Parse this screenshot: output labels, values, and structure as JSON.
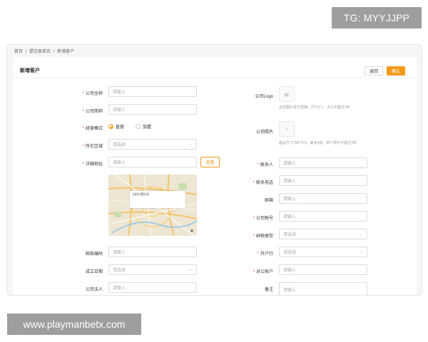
{
  "watermarks": {
    "top": "TG: MYYJJPP",
    "bottom": "www.playmanbetx.com"
  },
  "breadcrumb": [
    "首页",
    "/",
    "提交表单页",
    "/",
    "新增客户"
  ],
  "page": {
    "title": "新增客户",
    "back_label": "返回",
    "confirm_label": "确认"
  },
  "left_form": {
    "company_name": {
      "label": "公司全称",
      "placeholder": "请输入"
    },
    "company_short": {
      "label": "公司简称",
      "placeholder": "请输入"
    },
    "business_mode": {
      "label": "经营模式",
      "options": [
        "直营",
        "加盟"
      ],
      "selected": "直营"
    },
    "region": {
      "label": "所在区域",
      "placeholder": "请选择"
    },
    "address": {
      "label": "详细地址",
      "placeholder": "请输入",
      "view_label": "查看"
    },
    "map_popup": "当前位置信息...",
    "postcode": {
      "label": "邮政编码",
      "placeholder": "请输入"
    },
    "founded": {
      "label": "成立日期",
      "placeholder": "请选择"
    },
    "legal_person": {
      "label": "公司法人",
      "placeholder": "请输入"
    }
  },
  "right_form": {
    "logo": {
      "label": "公司Logo",
      "hint": "点击图片进行替换，尺寸1:1，大小不超过7M"
    },
    "photos": {
      "label": "公司照片",
      "hint": "建议尺寸750*370，最多4张，单个照片不超过7M"
    },
    "contact": {
      "label": "联系人",
      "placeholder": "请输入"
    },
    "phone": {
      "label": "联系电话",
      "placeholder": "请输入"
    },
    "email": {
      "label": "邮箱",
      "placeholder": "请输入"
    },
    "tax_no": {
      "label": "公司税号",
      "placeholder": "请输入"
    },
    "tax_type": {
      "label": "纳税类型",
      "placeholder": "请选择"
    },
    "bank": {
      "label": "开户行",
      "placeholder": "请选择"
    },
    "account": {
      "label": "对公账户",
      "placeholder": "请输入"
    },
    "remark": {
      "label": "备注",
      "placeholder": "请输入"
    }
  },
  "icons": {
    "chevron": "chevron-down-icon",
    "calendar": "calendar-icon",
    "image": "image-icon",
    "plus": "plus-icon"
  },
  "colors": {
    "accent": "#f39a1a",
    "required": "#e44444"
  }
}
